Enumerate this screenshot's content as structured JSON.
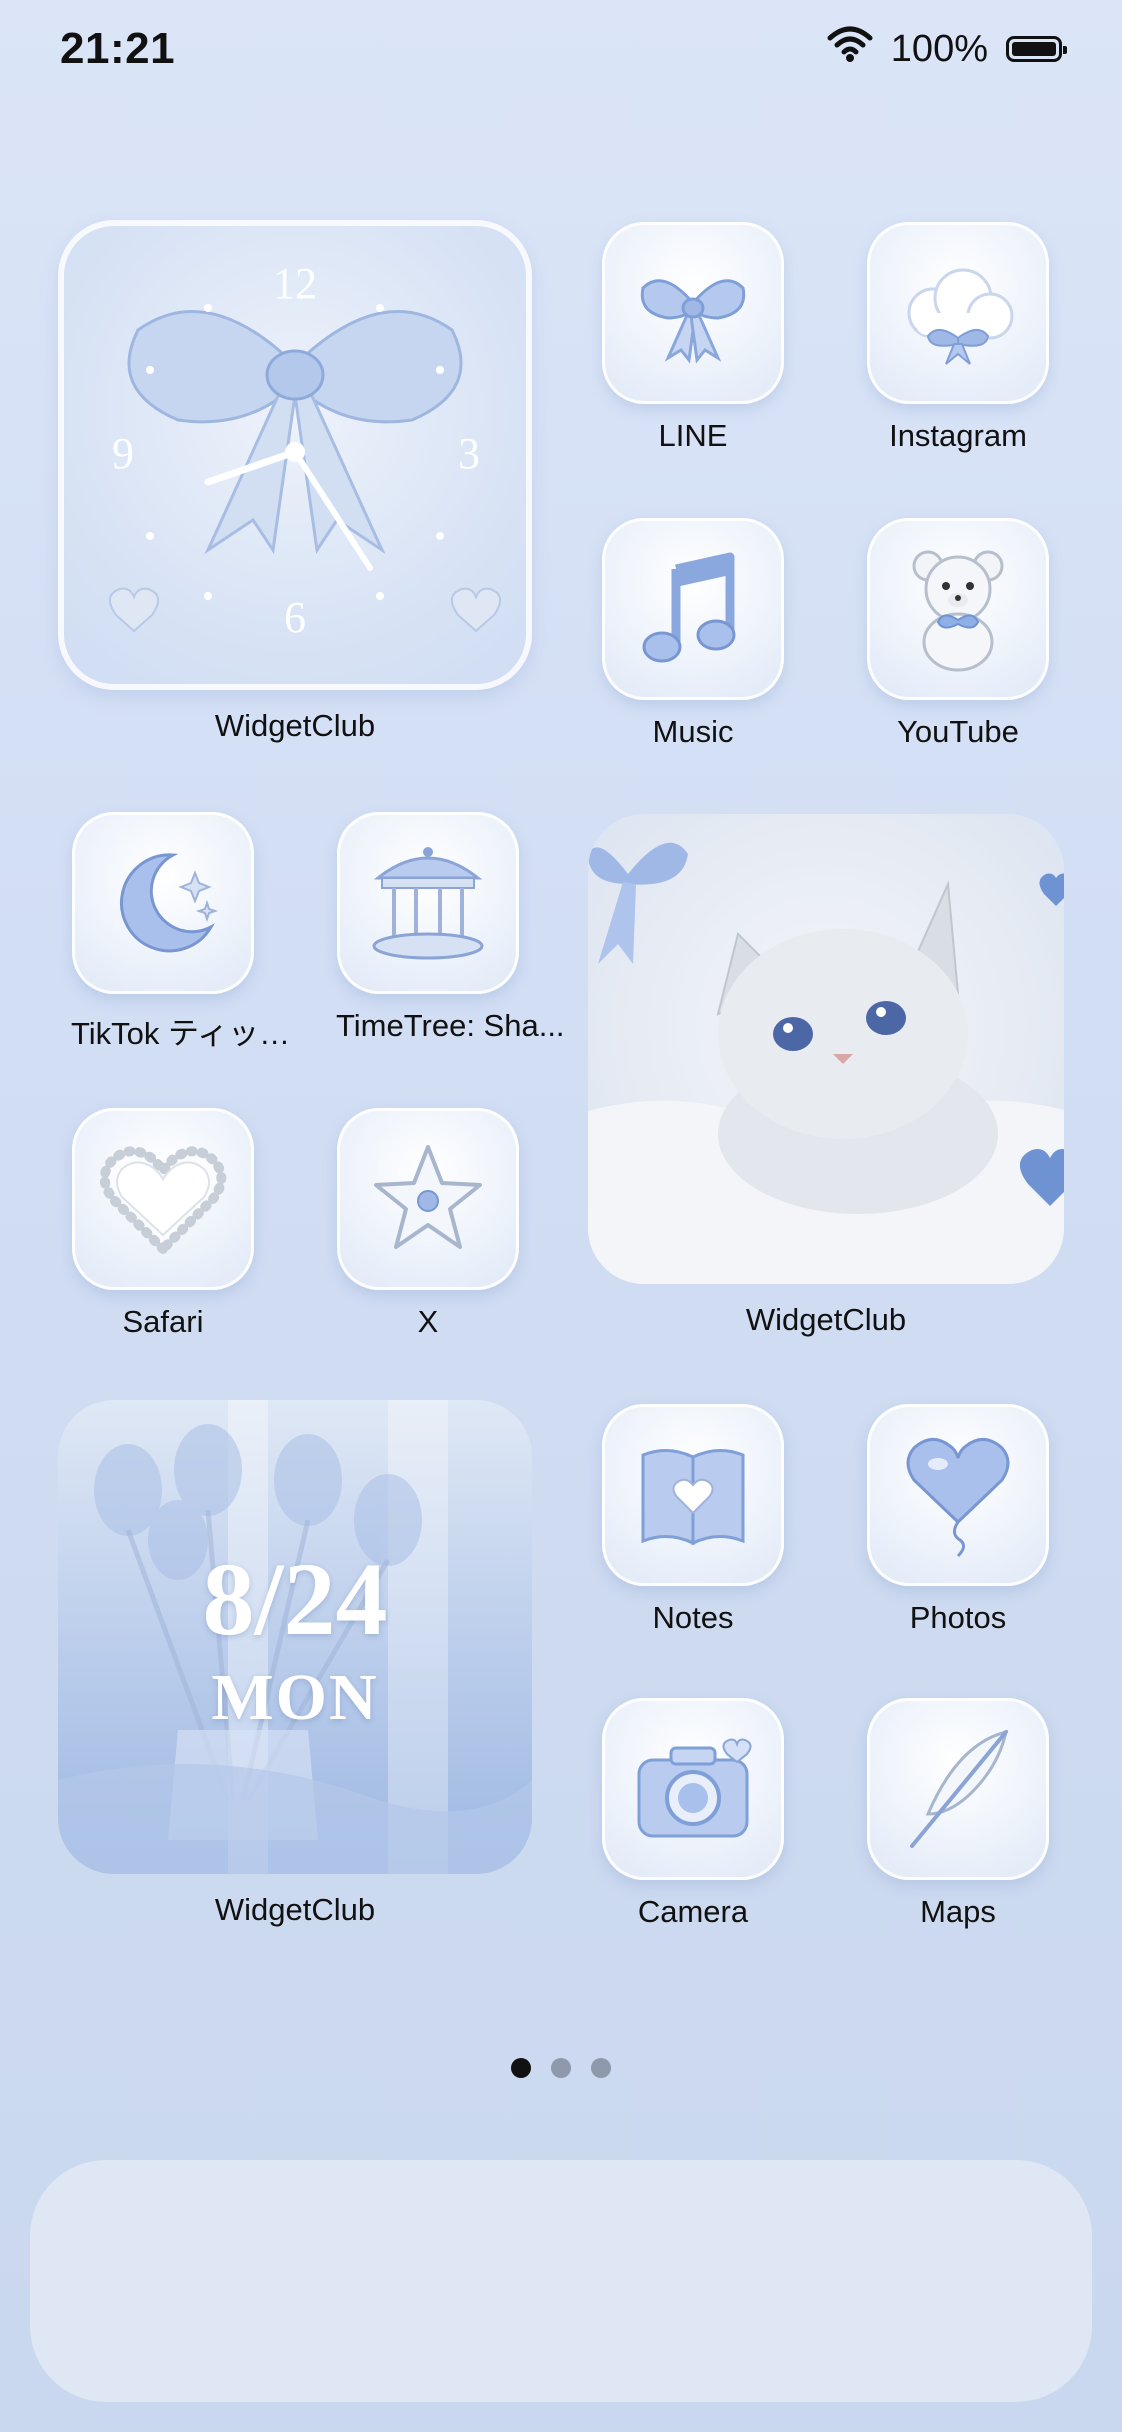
{
  "status_bar": {
    "time": "21:21",
    "battery": "100%"
  },
  "clock_widget": {
    "label": "WidgetClub",
    "numerals": {
      "twelve": "12",
      "three": "3",
      "six": "6",
      "nine": "9"
    }
  },
  "apps": [
    {
      "label": "LINE",
      "icon": "bow-icon"
    },
    {
      "label": "Instagram",
      "icon": "cloud-bow-icon"
    },
    {
      "label": "Music",
      "icon": "music-note-icon"
    },
    {
      "label": "YouTube",
      "icon": "teddy-bear-icon"
    },
    {
      "label": "TikTok ティッ…",
      "icon": "crescent-moon-icon"
    },
    {
      "label": "TimeTree: Sha...",
      "icon": "carousel-icon"
    },
    {
      "label": "Safari",
      "icon": "pearl-heart-icon"
    },
    {
      "label": "X",
      "icon": "star-icon"
    },
    {
      "label": "Notes",
      "icon": "book-heart-icon"
    },
    {
      "label": "Photos",
      "icon": "heart-balloon-icon"
    },
    {
      "label": "Camera",
      "icon": "camera-icon"
    },
    {
      "label": "Maps",
      "icon": "feather-icon"
    }
  ],
  "cat_widget": {
    "label": "WidgetClub"
  },
  "date_widget": {
    "label": "WidgetClub",
    "date": "8/24",
    "day": "MON"
  },
  "page_indicator": {
    "pages": 3,
    "current": 1
  },
  "colors": {
    "accent": "#a9c1ea",
    "background": "#d2def4"
  }
}
